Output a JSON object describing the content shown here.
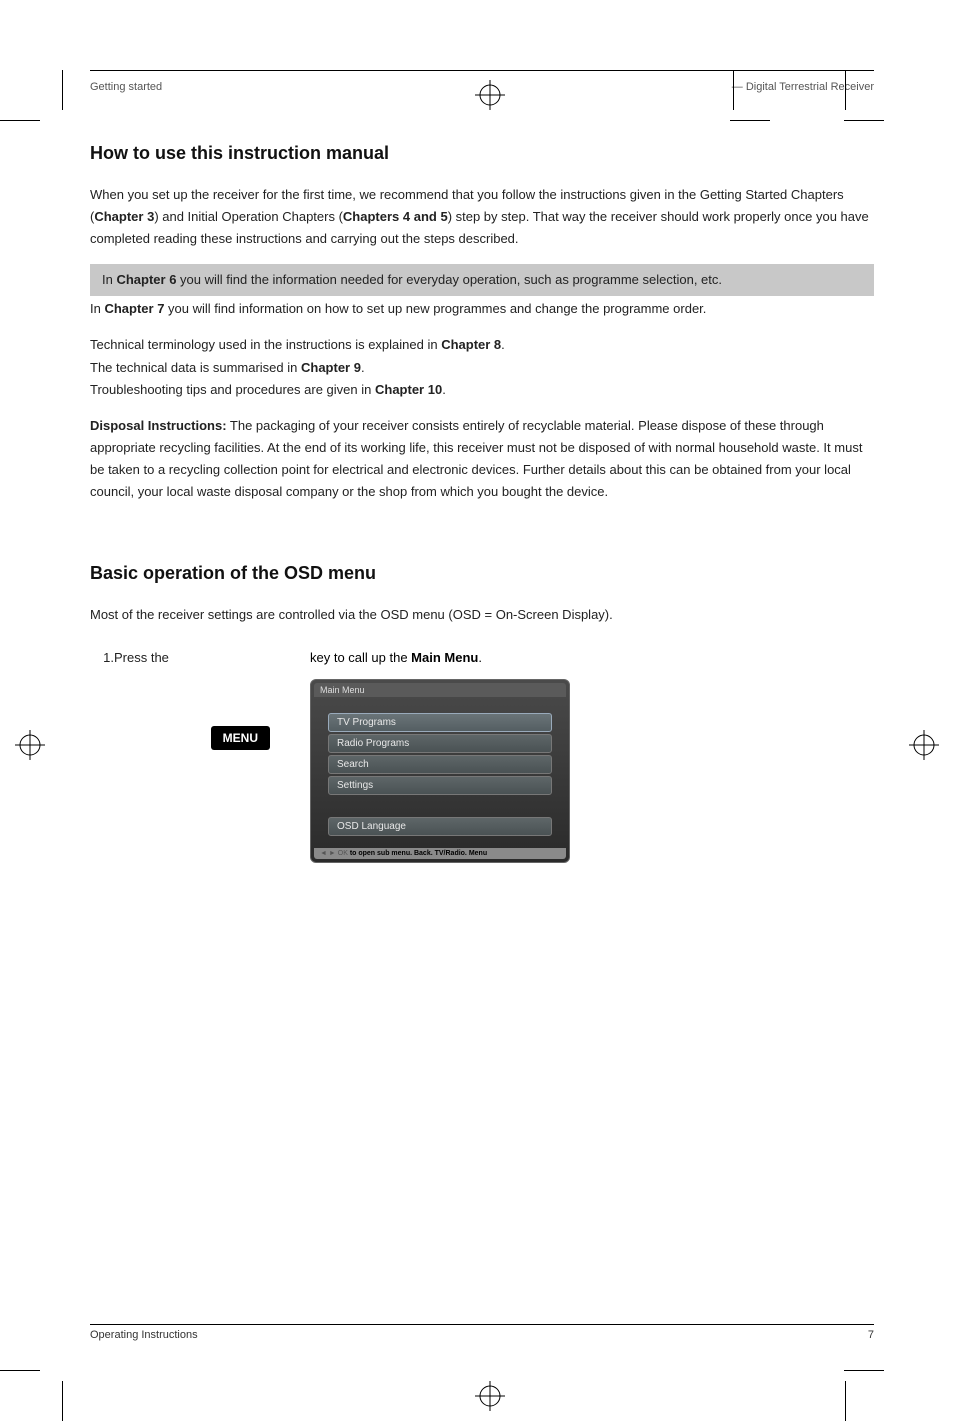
{
  "header": {
    "left": "Getting started",
    "right": "— Digital Terrestrial Receiver"
  },
  "section1": {
    "title": "How to use this instruction manual"
  },
  "para1_pre": "When you set up the receiver for the first time, we recommend that you follow the instructions given in the Getting Started Chapters (",
  "para1_bold1": "Chapter 3",
  "para1_mid": ") and Initial Operation Chapters (",
  "para1_bold2": "Chapters 4 and 5",
  "para1_post": ") step by step. That way the receiver should work properly once you have completed reading these instructions and carrying out the steps described.",
  "hl1_pre": "In ",
  "hl1_bold": "Chapter 6",
  "hl1_post": " you will find the information needed for everyday operation, such as programme selection, etc.",
  "hl2_pre": "In ",
  "hl2_bold": "Chapter 7",
  "hl2_post": " you will find information on how to set up new programmes and change the programme order.",
  "para2_pre": "Technical terminology used in the instructions is explained in ",
  "para2_bold1": "Chapter 8",
  "para2_post1": ".",
  "para3_pre": "The technical data is summarised in ",
  "para3_bold1": "Chapter 9",
  "para3_post1": ".",
  "para4_pre": "Troubleshooting tips and procedures are given in ",
  "para4_bold1": "Chapter 10",
  "para4_post1": ".",
  "disposal": {
    "label": "Disposal Instructions:",
    "text": " The packaging of your receiver consists entirely of recyclable material. Please dispose of these through appropriate recycling facilities. At the end of its working life, this receiver must not be disposed of with normal household waste. It must be taken to a recycling collection point for electrical and electronic devices. Further details about this can be obtained from your local council, your local waste disposal company or the shop from which you bought the device."
  },
  "section2": {
    "title": "Basic operation of the OSD menu"
  },
  "menu_intro": "Most of the receiver settings are controlled via the OSD menu (OSD = On-Screen Display).",
  "steps": [
    {
      "num": "1.",
      "pre": "Press the ",
      "key": "MENU",
      "post": " key to call up the ",
      "bold": "Main Menu",
      "end": "."
    }
  ],
  "osd": {
    "title": "Main Menu",
    "items": [
      "TV Programs",
      "Radio Programs",
      "Search",
      "Settings"
    ],
    "bottom_item": "OSD Language",
    "footer": "to open sub menu.    Back.   TV/Radio. Menu"
  },
  "footer": {
    "left": "Operating Instructions",
    "right": "7"
  }
}
